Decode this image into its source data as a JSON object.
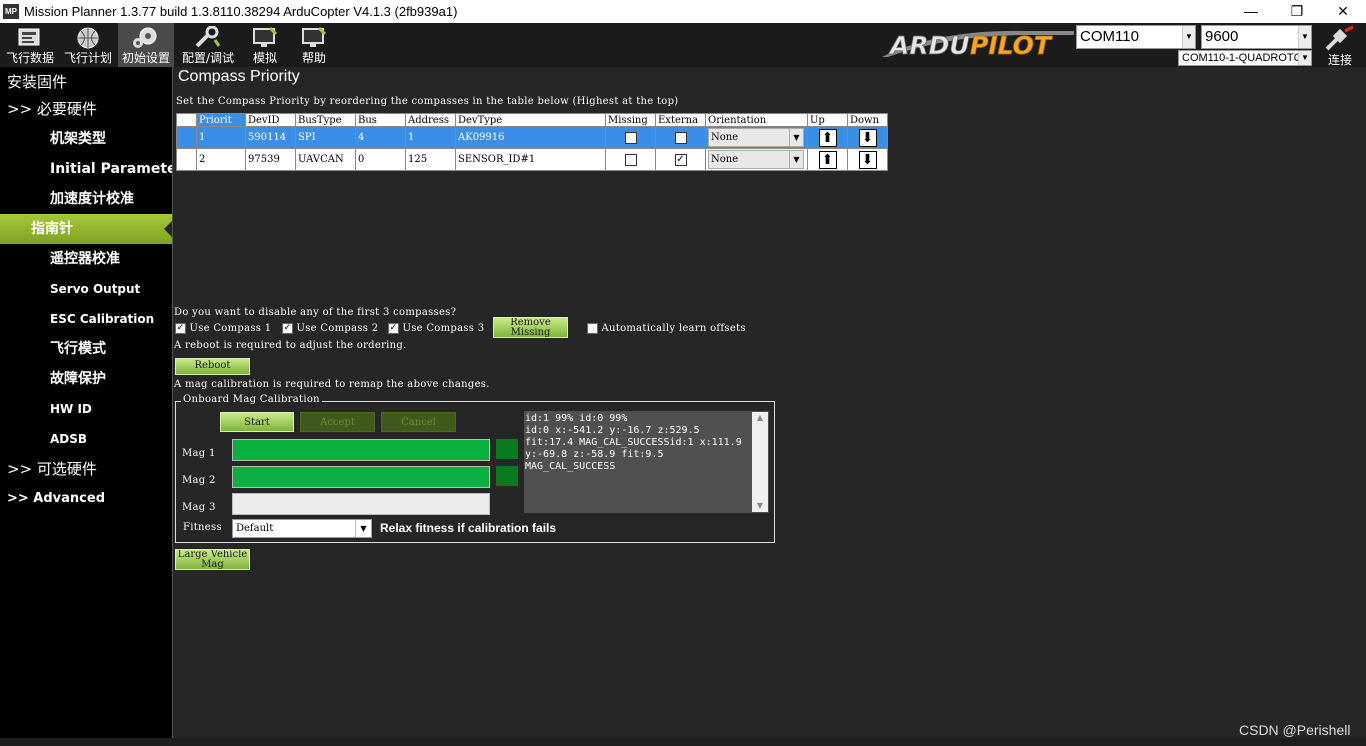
{
  "window": {
    "app_icon": "MP",
    "title": "Mission Planner 1.3.77 build 1.3.8110.38294 ArduCopter V4.1.3 (2fb939a1)",
    "min": "—",
    "restore": "❐",
    "close": "✕"
  },
  "toolbar": {
    "items": [
      {
        "label": "飞行数据",
        "icon": "flight-data-icon"
      },
      {
        "label": "飞行计划",
        "icon": "flight-plan-icon"
      },
      {
        "label": "初始设置",
        "icon": "initial-setup-icon"
      },
      {
        "label": "配置/调试",
        "icon": "config-tuning-icon"
      },
      {
        "label": "模拟",
        "icon": "simulation-icon"
      },
      {
        "label": "帮助",
        "icon": "help-icon"
      }
    ],
    "logo_text_a": "ARDU",
    "logo_text_b": "PILOT",
    "port": "COM110",
    "baud": "9600",
    "port_detail": "COM110-1-QUADROTC",
    "connect_label": "连接"
  },
  "sidebar": {
    "items": [
      {
        "label": "安装固件"
      },
      {
        "label": ">> 必要硬件"
      },
      {
        "label": "机架类型"
      },
      {
        "label": "Initial Paramete"
      },
      {
        "label": "加速度计校准"
      },
      {
        "label": "指南针"
      },
      {
        "label": "遥控器校准"
      },
      {
        "label": "Servo Output"
      },
      {
        "label": "ESC Calibration"
      },
      {
        "label": "飞行模式"
      },
      {
        "label": "故障保护"
      },
      {
        "label": "HW ID"
      },
      {
        "label": "ADSB"
      },
      {
        "label": ">> 可选硬件"
      },
      {
        "label": ">> Advanced"
      }
    ],
    "active_index": 5
  },
  "main": {
    "heading": "Compass Priority",
    "instruction": "Set the Compass Priority by reordering the compasses in the table below (Highest at the top)",
    "table": {
      "headers": [
        "Priorit",
        "DevID",
        "BusType",
        "Bus",
        "Address",
        "DevType",
        "Missing",
        "Externa",
        "Orientation",
        "Up",
        "Down"
      ],
      "rows": [
        {
          "priority": "1",
          "devid": "590114",
          "bustype": "SPI",
          "bus": "4",
          "address": "1",
          "devtype": "AK09916",
          "missing": false,
          "external": false,
          "orientation": "None"
        },
        {
          "priority": "2",
          "devid": "97539",
          "bustype": "UAVCAN",
          "bus": "0",
          "address": "125",
          "devtype": "SENSOR_ID#1",
          "missing": false,
          "external": true,
          "orientation": "None"
        }
      ]
    },
    "disable_question": "Do you want to disable any of the first 3 compasses?",
    "use_compass_1": "Use Compass 1",
    "use_compass_2": "Use Compass 2",
    "use_compass_3": "Use Compass 3",
    "remove_missing": "Remove Missing",
    "auto_learn": "Automatically learn offsets",
    "reboot_note": "A reboot is required to adjust the ordering.",
    "reboot_button": "Reboot",
    "remap_note": "A mag calibration is required to remap the above changes.",
    "onboard": {
      "legend": "Onboard Mag Calibration",
      "start": "Start",
      "accept": "Accept",
      "cancel": "Cancel",
      "mag1": "Mag 1",
      "mag2": "Mag 2",
      "mag3": "Mag 3",
      "mag1_progress": 100,
      "mag2_progress": 100,
      "mag3_progress": 0,
      "fitness_label": "Fitness",
      "fitness_value": "Default",
      "relax_label": "Relax fitness if calibration fails",
      "log": "id:1 99% id:0 99%\nid:0 x:-541.2 y:-16.7 z:529.5\nfit:17.4 MAG_CAL_SUCCESSid:1 x:111.9\ny:-69.8 z:-58.9 fit:9.5\nMAG_CAL_SUCCESS"
    },
    "large_vehicle_mag": "Large Vehicle Mag"
  },
  "watermark": "CSDN @Perishell"
}
